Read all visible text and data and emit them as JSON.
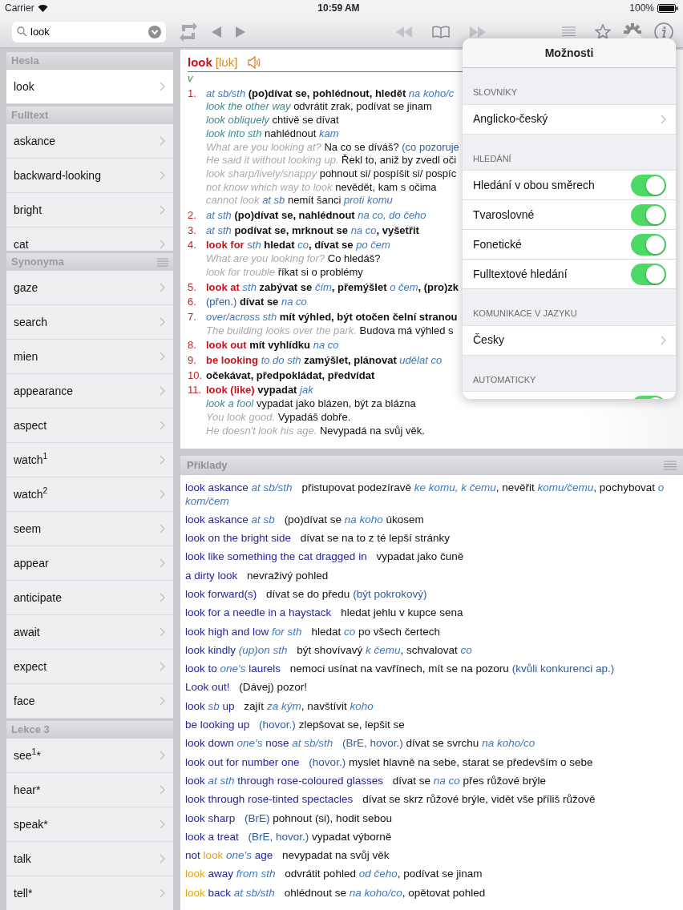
{
  "status_bar": {
    "carrier": "Carrier",
    "time": "10:59 AM",
    "battery": "100%"
  },
  "toolbar": {
    "search": {
      "value": "look"
    },
    "rewind_disabled": true,
    "forward_disabled": true
  },
  "sidebar": [
    {
      "title": "Hesla",
      "menu": false,
      "clip": false,
      "items": [
        {
          "label": "look",
          "selected": true
        }
      ]
    },
    {
      "title": "Fulltext",
      "menu": false,
      "clip": true,
      "items": [
        {
          "label": "askance",
          "selected": false
        },
        {
          "label": "backward-looking",
          "selected": false
        },
        {
          "label": "bright",
          "selected": false
        },
        {
          "label": "cat",
          "selected": false
        }
      ]
    },
    {
      "title": "Synonyma",
      "menu": true,
      "clip": false,
      "items": [
        {
          "label": "gaze",
          "selected": false
        },
        {
          "label": "search",
          "selected": false
        },
        {
          "label": "mien",
          "selected": false
        },
        {
          "label": "appearance",
          "selected": false
        },
        {
          "label": "aspect",
          "selected": false
        },
        {
          "label": "watch$^{1}$",
          "selected": false
        },
        {
          "label": "watch$^{2}$",
          "selected": false
        },
        {
          "label": "seem",
          "selected": false
        },
        {
          "label": "appear",
          "selected": false
        },
        {
          "label": "anticipate",
          "selected": false
        },
        {
          "label": "await",
          "selected": false
        },
        {
          "label": "expect",
          "selected": false
        },
        {
          "label": "face",
          "selected": false
        }
      ]
    },
    {
      "title": "Lekce 3",
      "menu": false,
      "clip": false,
      "items": [
        {
          "label": "see$^{1}$*",
          "selected": false
        },
        {
          "label": "hear*",
          "selected": false
        },
        {
          "label": "speak*",
          "selected": false
        },
        {
          "label": "talk",
          "selected": false
        },
        {
          "label": "tell*",
          "selected": false
        }
      ]
    }
  ],
  "entry": {
    "headword": "look",
    "pronunciation": "[lʊk]",
    "pos": "v",
    "senses": [
      {
        "number": "1.",
        "parts": [
          {
            "kind": "gram",
            "text": "at sb/sth"
          },
          {
            "kind": "trans",
            "text": "(po)dívat se, pohlédnout, hledět"
          },
          {
            "kind": "gram",
            "text": "na koho/c"
          }
        ],
        "examples": [
          [
            {
              "kind": "phrase",
              "text": "look the other way"
            },
            {
              "kind": "plain",
              "text": "odvrátit zrak, podívat se jinam"
            }
          ],
          [
            {
              "kind": "phrase",
              "text": "look obliquely"
            },
            {
              "kind": "plain",
              "text": "chtivě se dívat"
            }
          ],
          [
            {
              "kind": "phrase",
              "text": "look into sth"
            },
            {
              "kind": "plain",
              "text": "nahlédnout"
            },
            {
              "kind": "gram",
              "text": "kam"
            }
          ],
          [
            {
              "kind": "sample",
              "text": "What are you looking at?"
            },
            {
              "kind": "plain",
              "text": "Na co se díváš?"
            },
            {
              "kind": "label",
              "text": "(co pozoruje"
            }
          ],
          [
            {
              "kind": "sample",
              "text": "He said it without looking up."
            },
            {
              "kind": "plain",
              "text": "Řekl to, aniž by zvedl oči"
            }
          ],
          [
            {
              "kind": "sample",
              "text": "look sharp/lively/snappy"
            },
            {
              "kind": "plain",
              "text": "pohnout si/ pospíšit si/ pospíc"
            }
          ],
          [
            {
              "kind": "sample",
              "text": "not know which way to look"
            },
            {
              "kind": "plain",
              "text": "nevědět, kam s očima"
            }
          ],
          [
            {
              "kind": "sample",
              "text": "cannot look"
            },
            {
              "kind": "gram",
              "text": "at sb"
            },
            {
              "kind": "plain",
              "text": "nemít šanci"
            },
            {
              "kind": "gram",
              "text": "proti komu"
            }
          ]
        ]
      },
      {
        "number": "2.",
        "parts": [
          {
            "kind": "gram",
            "text": "at sth"
          },
          {
            "kind": "trans",
            "text": "(po)dívat se, nahlédnout"
          },
          {
            "kind": "gram",
            "text": "na co, do čeho"
          }
        ]
      },
      {
        "number": "3.",
        "parts": [
          {
            "kind": "gram",
            "text": "at sth"
          },
          {
            "kind": "trans",
            "text": "podívat se, mrknout se"
          },
          {
            "kind": "gram",
            "text": "na co"
          },
          {
            "kind": "trans",
            "text": ", vyšetřit",
            "tight": true
          }
        ]
      },
      {
        "number": "4.",
        "parts": [
          {
            "kind": "head",
            "text": "look for"
          },
          {
            "kind": "gram",
            "text": "sth"
          },
          {
            "kind": "trans",
            "text": "hledat"
          },
          {
            "kind": "gram",
            "text": "co"
          },
          {
            "kind": "trans",
            "text": ", dívat se",
            "tight": true
          },
          {
            "kind": "gram",
            "text": "po čem"
          }
        ],
        "examples": [
          [
            {
              "kind": "sample",
              "text": "What are you looking for?"
            },
            {
              "kind": "plain",
              "text": "Co hledáš?"
            }
          ],
          [
            {
              "kind": "sample",
              "text": "look for trouble"
            },
            {
              "kind": "plain",
              "text": "říkat si o problémy"
            }
          ]
        ]
      },
      {
        "number": "5.",
        "parts": [
          {
            "kind": "head",
            "text": "look at"
          },
          {
            "kind": "gram",
            "text": "sth"
          },
          {
            "kind": "trans",
            "text": "zabývat se"
          },
          {
            "kind": "gram",
            "text": "čím"
          },
          {
            "kind": "trans",
            "text": ", přemýšlet",
            "tight": true
          },
          {
            "kind": "gram",
            "text": "o čem"
          },
          {
            "kind": "trans",
            "text": ", (pro)zk",
            "tight": true
          }
        ]
      },
      {
        "number": "6.",
        "parts": [
          {
            "kind": "label",
            "text": "(přen.)"
          },
          {
            "kind": "trans",
            "text": "dívat se"
          },
          {
            "kind": "gram",
            "text": "na co"
          }
        ]
      },
      {
        "number": "7.",
        "parts": [
          {
            "kind": "gram",
            "text": "over/across sth"
          },
          {
            "kind": "trans",
            "text": "mít výhled, být otočen čelní stranou"
          }
        ],
        "examples": [
          [
            {
              "kind": "sample",
              "text": "The building looks over the park."
            },
            {
              "kind": "plain",
              "text": "Budova má výhled s"
            }
          ]
        ]
      },
      {
        "number": "8.",
        "parts": [
          {
            "kind": "head",
            "text": "look out"
          },
          {
            "kind": "trans",
            "text": "mít vyhlídku"
          },
          {
            "kind": "gram",
            "text": "na co"
          }
        ]
      },
      {
        "number": "9.",
        "parts": [
          {
            "kind": "head",
            "text": "be looking"
          },
          {
            "kind": "gram",
            "text": "to do sth"
          },
          {
            "kind": "trans",
            "text": "zamýšlet, plánovat"
          },
          {
            "kind": "gram",
            "text": "udělat co"
          }
        ]
      },
      {
        "number": "10.",
        "parts": [
          {
            "kind": "trans",
            "text": "očekávat, předpokládat, předvídat"
          }
        ]
      },
      {
        "number": "11.",
        "parts": [
          {
            "kind": "head",
            "text": "look (like)"
          },
          {
            "kind": "trans",
            "text": "vypadat"
          },
          {
            "kind": "gram",
            "text": "jak"
          }
        ],
        "examples": [
          [
            {
              "kind": "phrase",
              "text": "look a fool"
            },
            {
              "kind": "plain",
              "text": "vypadat jako blázen, být za blázna"
            }
          ],
          [
            {
              "kind": "sample",
              "text": "You look good."
            },
            {
              "kind": "plain",
              "text": "Vypadáš dobře."
            }
          ],
          [
            {
              "kind": "sample",
              "text": "He doesn't look his age."
            },
            {
              "kind": "plain",
              "text": "Nevypadá na svůj věk."
            }
          ]
        ]
      }
    ]
  },
  "examples_panel": {
    "title": "Příklady",
    "items": [
      {
        "phrase": [
          {
            "kind": "en",
            "text": "look askance"
          },
          {
            "kind": "gram",
            "text": "at sb/sth"
          }
        ],
        "meaning": [
          {
            "kind": "plain",
            "text": "přistupovat podezíravě"
          },
          {
            "kind": "gram",
            "text": "ke komu, k čemu"
          },
          {
            "kind": "plain",
            "text": ", nevěřit",
            "tight": true
          },
          {
            "kind": "gram",
            "text": "komu/čemu"
          },
          {
            "kind": "plain",
            "text": ", pochybovat",
            "tight": true
          },
          {
            "kind": "gram",
            "text": "o kom/čem"
          }
        ]
      },
      {
        "phrase": [
          {
            "kind": "en",
            "text": "look askance"
          },
          {
            "kind": "gram",
            "text": "at sb"
          }
        ],
        "meaning": [
          {
            "kind": "plain",
            "text": "(po)dívat se"
          },
          {
            "kind": "gram",
            "text": "na koho"
          },
          {
            "kind": "plain",
            "text": "úkosem"
          }
        ]
      },
      {
        "phrase": [
          {
            "kind": "en",
            "text": "look on the bright side"
          }
        ],
        "meaning": [
          {
            "kind": "plain",
            "text": "dívat se na to z té lepší stránky"
          }
        ]
      },
      {
        "phrase": [
          {
            "kind": "en",
            "text": "look like something the cat dragged in"
          }
        ],
        "meaning": [
          {
            "kind": "plain",
            "text": "vypadat jako čuně"
          }
        ]
      },
      {
        "phrase": [
          {
            "kind": "en",
            "text": "a dirty look"
          }
        ],
        "meaning": [
          {
            "kind": "plain",
            "text": "nevraživý pohled"
          }
        ]
      },
      {
        "phrase": [
          {
            "kind": "en",
            "text": "look forward(s)"
          }
        ],
        "meaning": [
          {
            "kind": "plain",
            "text": "dívat se do předu"
          },
          {
            "kind": "label",
            "text": "(být pokrokový)"
          }
        ]
      },
      {
        "phrase": [
          {
            "kind": "en",
            "text": "look for a needle in a haystack"
          }
        ],
        "meaning": [
          {
            "kind": "plain",
            "text": "hledat jehlu v kupce sena"
          }
        ]
      },
      {
        "phrase": [
          {
            "kind": "en",
            "text": "look high and low"
          },
          {
            "kind": "gram",
            "text": "for sth"
          }
        ],
        "meaning": [
          {
            "kind": "plain",
            "text": "hledat"
          },
          {
            "kind": "gram",
            "text": "co"
          },
          {
            "kind": "plain",
            "text": "po všech čertech"
          }
        ]
      },
      {
        "phrase": [
          {
            "kind": "en",
            "text": "look kindly"
          },
          {
            "kind": "gram",
            "text": "(up)on sth"
          }
        ],
        "meaning": [
          {
            "kind": "plain",
            "text": "být shovívavý"
          },
          {
            "kind": "gram",
            "text": "k čemu"
          },
          {
            "kind": "plain",
            "text": ", schvalovat",
            "tight": true
          },
          {
            "kind": "gram",
            "text": "co"
          }
        ]
      },
      {
        "phrase": [
          {
            "kind": "en",
            "text": "look to"
          },
          {
            "kind": "gram",
            "text": "one's"
          },
          {
            "kind": "en",
            "text": "laurels"
          }
        ],
        "meaning": [
          {
            "kind": "plain",
            "text": "nemoci usínat na vavřínech, mít se na pozoru"
          },
          {
            "kind": "label",
            "text": "(kvůli konkurenci ap.)"
          }
        ]
      },
      {
        "phrase": [
          {
            "kind": "en",
            "text": "Look out!"
          }
        ],
        "meaning": [
          {
            "kind": "plain",
            "text": "(Dávej) pozor!"
          }
        ]
      },
      {
        "phrase": [
          {
            "kind": "en",
            "text": "look"
          },
          {
            "kind": "gram",
            "text": "sb"
          },
          {
            "kind": "en",
            "text": "up"
          }
        ],
        "meaning": [
          {
            "kind": "plain",
            "text": "zajít"
          },
          {
            "kind": "gram",
            "text": "za kým"
          },
          {
            "kind": "plain",
            "text": ", navštívit",
            "tight": true
          },
          {
            "kind": "gram",
            "text": "koho"
          }
        ]
      },
      {
        "phrase": [
          {
            "kind": "en",
            "text": "be looking up"
          }
        ],
        "meaning": [
          {
            "kind": "label",
            "text": "(hovor.)"
          },
          {
            "kind": "plain",
            "text": "zlepšovat se, lepšit se"
          }
        ]
      },
      {
        "phrase": [
          {
            "kind": "en",
            "text": "look down"
          },
          {
            "kind": "gram",
            "text": "one's"
          },
          {
            "kind": "en",
            "text": "nose"
          },
          {
            "kind": "gram",
            "text": "at sb/sth"
          }
        ],
        "meaning": [
          {
            "kind": "label",
            "text": "(BrE, hovor.)"
          },
          {
            "kind": "plain",
            "text": "dívat se svrchu"
          },
          {
            "kind": "gram",
            "text": "na koho/co"
          }
        ]
      },
      {
        "phrase": [
          {
            "kind": "en",
            "text": "look out for number one"
          }
        ],
        "meaning": [
          {
            "kind": "label",
            "text": "(hovor.)"
          },
          {
            "kind": "plain",
            "text": "myslet hlavně na sebe, starat se především o sebe"
          }
        ]
      },
      {
        "phrase": [
          {
            "kind": "en",
            "text": "look"
          },
          {
            "kind": "gram",
            "text": "at sth"
          },
          {
            "kind": "en",
            "text": "through rose-coloured glasses"
          }
        ],
        "meaning": [
          {
            "kind": "plain",
            "text": "dívat se"
          },
          {
            "kind": "gram",
            "text": "na co"
          },
          {
            "kind": "plain",
            "text": "přes růžové brýle"
          }
        ]
      },
      {
        "phrase": [
          {
            "kind": "en",
            "text": "look through rose-tinted spectacles"
          }
        ],
        "meaning": [
          {
            "kind": "plain",
            "text": "dívat se skrz růžové brýle, vidět vše příliš růžově"
          }
        ]
      },
      {
        "phrase": [
          {
            "kind": "en",
            "text": "look sharp"
          }
        ],
        "meaning": [
          {
            "kind": "label",
            "text": "(BrE)"
          },
          {
            "kind": "plain",
            "text": "pohnout (si), hodit sebou"
          }
        ]
      },
      {
        "phrase": [
          {
            "kind": "en",
            "text": "look a treat"
          }
        ],
        "meaning": [
          {
            "kind": "label",
            "text": "(BrE, hovor.)"
          },
          {
            "kind": "plain",
            "text": "vypadat výborně"
          }
        ]
      },
      {
        "phrase": [
          {
            "kind": "en",
            "text": "not"
          },
          {
            "kind": "hit",
            "text": "look"
          },
          {
            "kind": "gram",
            "text": "one's"
          },
          {
            "kind": "en",
            "text": "age"
          }
        ],
        "meaning": [
          {
            "kind": "plain",
            "text": "nevypadat na svůj věk"
          }
        ]
      },
      {
        "phrase": [
          {
            "kind": "hit",
            "text": "look"
          },
          {
            "kind": "en",
            "text": "away"
          },
          {
            "kind": "gram",
            "text": "from sth"
          }
        ],
        "meaning": [
          {
            "kind": "plain",
            "text": "odvrátit pohled"
          },
          {
            "kind": "gram",
            "text": "od čeho"
          },
          {
            "kind": "plain",
            "text": ", podívat se jinam",
            "tight": true
          }
        ]
      },
      {
        "phrase": [
          {
            "kind": "hit",
            "text": "look"
          },
          {
            "kind": "en",
            "text": "back"
          },
          {
            "kind": "gram",
            "text": "at sb/sth"
          }
        ],
        "meaning": [
          {
            "kind": "plain",
            "text": "ohlédnout se"
          },
          {
            "kind": "gram",
            "text": "na koho/co"
          },
          {
            "kind": "plain",
            "text": ", opětovat pohled",
            "tight": true
          }
        ]
      }
    ]
  },
  "popover": {
    "title": "Možnosti",
    "sections": [
      {
        "header": "SLOVNÍKY",
        "rows": [
          {
            "kind": "link",
            "label": "Anglicko-český"
          }
        ]
      },
      {
        "header": "HLEDÁNÍ",
        "rows": [
          {
            "kind": "toggle",
            "label": "Hledání v obou směrech",
            "on": true
          },
          {
            "kind": "toggle",
            "label": "Tvaroslovné",
            "on": true
          },
          {
            "kind": "toggle",
            "label": "Fonetické",
            "on": true
          },
          {
            "kind": "toggle",
            "label": "Fulltextové hledání",
            "on": true
          }
        ]
      },
      {
        "header": "KOMUNIKACE V JAZYKU",
        "rows": [
          {
            "kind": "link",
            "label": "Česky"
          }
        ]
      },
      {
        "header": "AUTOMATICKY",
        "rows": [
          {
            "kind": "toggle",
            "on": true
          }
        ]
      }
    ]
  }
}
